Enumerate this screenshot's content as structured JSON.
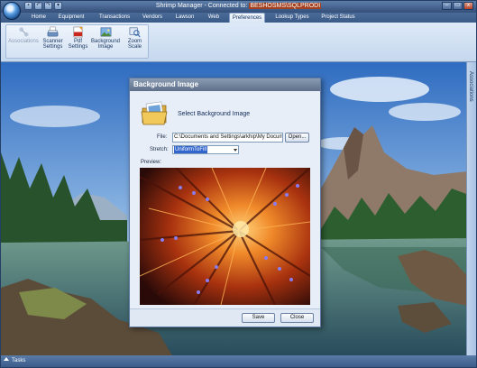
{
  "window": {
    "title_prefix": "Shrimp Manager - Connected to: ",
    "title_server": "BESHOSMS\\SQLPRODI",
    "qat_icons": [
      "save-icon",
      "undo-icon",
      "redo-icon",
      "customize-icon"
    ],
    "buttons": {
      "minimize": "–",
      "maximize": "□",
      "close": "x"
    }
  },
  "tabs": [
    {
      "label": "Home"
    },
    {
      "label": "Equipment"
    },
    {
      "label": "Transactions"
    },
    {
      "label": "Vendors"
    },
    {
      "label": "Lawson"
    },
    {
      "label": "Web"
    },
    {
      "label": "Preferences",
      "active": true
    },
    {
      "label": "Lookup Types"
    },
    {
      "label": "Project Status"
    }
  ],
  "ribbon": {
    "buttons": [
      {
        "line1": "Associations",
        "line2": "",
        "icon": "associations-icon",
        "disabled": true
      },
      {
        "line1": "Scanner",
        "line2": "Settings",
        "icon": "scanner-icon"
      },
      {
        "line1": "Pdf",
        "line2": "Settings",
        "icon": "pdf-icon"
      },
      {
        "line1": "Background",
        "line2": "Image",
        "icon": "image-icon"
      },
      {
        "line1": "Zoom",
        "line2": "Scale",
        "icon": "zoom-icon"
      }
    ]
  },
  "side_panel": {
    "label": "Associations"
  },
  "status": {
    "label": "Tasks"
  },
  "dialog": {
    "title": "Background Image",
    "heading": "Select Background Image",
    "file_label": "File:",
    "file_value": "C:\\Documents and Settings\\arkhip\\My Documents",
    "open_button": "Open...",
    "stretch_label": "Stretch:",
    "stretch_value": "UniformToFill",
    "preview_label": "Preview:",
    "save_button": "Save",
    "close_button": "Close"
  },
  "colors": {
    "title_bar": "#3f5d88",
    "ribbon": "#d5e3f4",
    "dialog_title": "#6c7e97",
    "selection": "#3366cc"
  }
}
